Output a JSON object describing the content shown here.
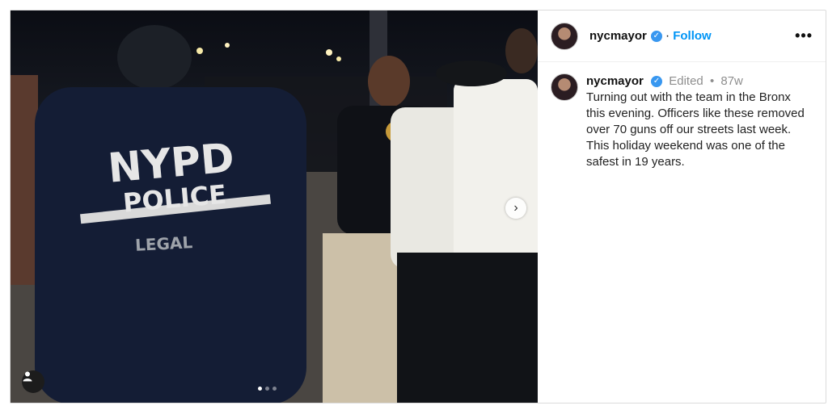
{
  "post": {
    "username": "nycmayor",
    "verified_icon": "verified-check-icon",
    "header_separator": "·",
    "follow_label": "Follow",
    "more_label": "•••",
    "edited_label": "Edited",
    "meta_separator": "•",
    "age": "87w",
    "caption": "Turning out with the team in the Bronx this evening. Officers like these removed over 70 guns off our streets last week. This holiday weekend was one of the safest in 19 years."
  },
  "photo": {
    "jacket_line1": "NYPD",
    "jacket_line2": "POLICE",
    "jacket_line3": "LEGAL",
    "carousel_count": 3,
    "carousel_active": 1
  },
  "controls": {
    "next_icon": "chevron-right-icon",
    "tag_icon": "person-tag-icon",
    "next_glyph": "›"
  }
}
